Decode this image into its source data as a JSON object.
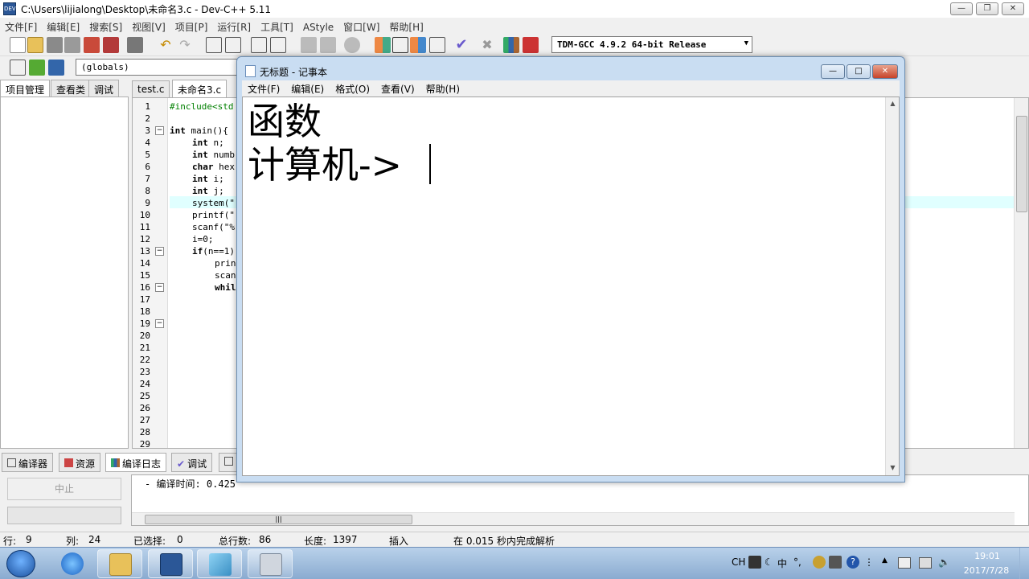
{
  "devcpp": {
    "title": "C:\\Users\\lijialong\\Desktop\\未命名3.c - Dev-C++ 5.11",
    "menus": [
      "文件[F]",
      "编辑[E]",
      "搜索[S]",
      "视图[V]",
      "项目[P]",
      "运行[R]",
      "工具[T]",
      "AStyle",
      "窗口[W]",
      "帮助[H]"
    ],
    "compiler": "TDM-GCC 4.9.2 64-bit Release",
    "scope": "(globals)",
    "left_tabs": [
      "项目管理",
      "查看类",
      "调试"
    ],
    "editor_tabs": [
      "test.c",
      "未命名3.c"
    ],
    "code": {
      "l1": "#include<std",
      "l3_kw": "int",
      "l3_rest": " main(){",
      "l4_kw": "int",
      "l4_rest": " n;",
      "l5_kw": "int",
      "l5_rest": " numb",
      "l6_kw": "char",
      "l6_rest": " hex",
      "l7_kw": "int",
      "l7_rest": " i;",
      "l8_kw": "int",
      "l8_rest": " j;",
      "l9": "system(\"",
      "l10": "printf(\"",
      "l11": "scanf(\"%",
      "l12": "i=0;",
      "l13_kw": "if",
      "l13_rest": "(n==1)",
      "l14": "prin",
      "l15": "scan",
      "l16": "whil"
    },
    "line_numbers": [
      "1",
      "2",
      "3",
      "4",
      "5",
      "6",
      "7",
      "8",
      "9",
      "10",
      "11",
      "12",
      "13",
      "14",
      "15",
      "16",
      "17",
      "18",
      "19",
      "20",
      "21",
      "22",
      "23",
      "24",
      "25",
      "26",
      "27",
      "28",
      "29"
    ],
    "bottom_tabs": [
      "编译器",
      "资源",
      "编译日志",
      "调试",
      ""
    ],
    "abort_label": "中止",
    "log_text": "- 编译时间: 0.425",
    "status": {
      "row_label": "行:",
      "row": "9",
      "col_label": "列:",
      "col": "24",
      "sel_label": "已选择:",
      "sel": "0",
      "total_label": "总行数:",
      "total": "86",
      "len_label": "长度:",
      "len": "1397",
      "mode": "插入",
      "parse": "在 0.015 秒内完成解析"
    }
  },
  "notepad": {
    "title": "无标题 - 记事本",
    "menus": [
      "文件(F)",
      "编辑(E)",
      "格式(O)",
      "查看(V)",
      "帮助(H)"
    ],
    "lines": [
      "函数",
      "计算机->"
    ]
  },
  "taskbar": {
    "ime": "CH",
    "ime_mode": "中",
    "ime_punct": "°,",
    "time": "19:01",
    "date": "2017/7/28"
  }
}
